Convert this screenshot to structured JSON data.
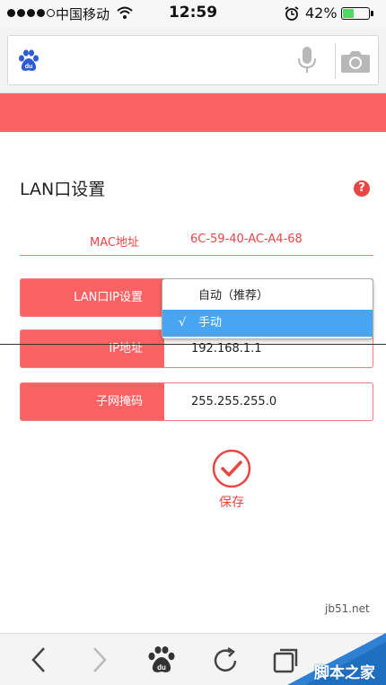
{
  "status_bar": {
    "carrier": "中国移动",
    "time": "12:59",
    "battery_percent": "42%",
    "battery_level": 0.42
  },
  "browser": {
    "logo_text": "du",
    "icons": [
      "baidu-logo-icon",
      "microphone-icon",
      "camera-icon"
    ]
  },
  "page": {
    "title": "LAN口设置",
    "help_icon": "?",
    "mac": {
      "label": "MAC地址",
      "value": "6C-59-40-AC-A4-68"
    },
    "rows": [
      {
        "label": "LAN口IP设置",
        "value": ""
      },
      {
        "label": "IP地址",
        "value": "192.168.1.1"
      },
      {
        "label": "子网掩码",
        "value": "255.255.255.0"
      }
    ],
    "dropdown": {
      "options": [
        "自动（推荐）",
        "手动"
      ],
      "selected_index": 1,
      "check": "√"
    },
    "save_label": "保存"
  },
  "toolbar": {
    "icons": [
      "back-icon",
      "forward-icon",
      "baidu-paw-icon",
      "refresh-icon",
      "tabs-icon"
    ]
  },
  "watermark": {
    "url": "jb51.net",
    "text": "脚本之家"
  },
  "colors": {
    "accent_red": "#fb6263",
    "dropdown_selected": "#4aa5f0",
    "battery_green": "#4cd964"
  }
}
